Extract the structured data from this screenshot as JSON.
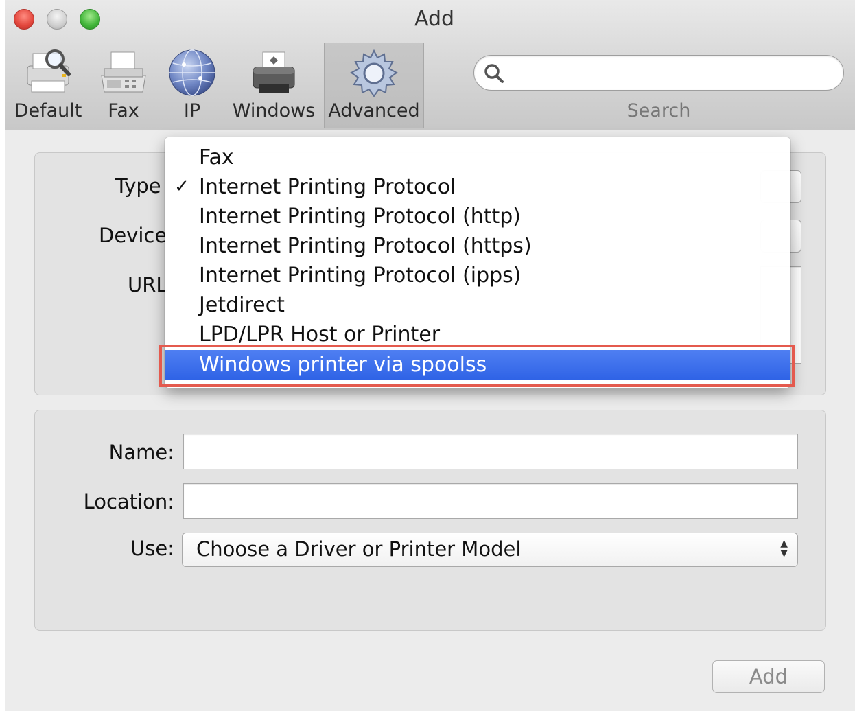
{
  "window": {
    "title": "Add"
  },
  "toolbar": {
    "items": [
      {
        "label": "Default",
        "icon": "default-printer-icon"
      },
      {
        "label": "Fax",
        "icon": "fax-icon"
      },
      {
        "label": "IP",
        "icon": "globe-icon"
      },
      {
        "label": "Windows",
        "icon": "printer-icon"
      },
      {
        "label": "Advanced",
        "icon": "gear-icon",
        "selected": true
      }
    ],
    "search": {
      "label": "Search",
      "value": ""
    }
  },
  "connection_group": {
    "type_label": "Type",
    "device_label": "Device",
    "url_label": "URL"
  },
  "dropdown_menu": {
    "items": [
      {
        "label": "Fax",
        "checked": false,
        "highlighted": false
      },
      {
        "label": "Internet Printing Protocol",
        "checked": true,
        "highlighted": false
      },
      {
        "label": "Internet Printing Protocol (http)",
        "checked": false,
        "highlighted": false
      },
      {
        "label": "Internet Printing Protocol (https)",
        "checked": false,
        "highlighted": false
      },
      {
        "label": "Internet Printing Protocol (ipps)",
        "checked": false,
        "highlighted": false
      },
      {
        "label": "Jetdirect",
        "checked": false,
        "highlighted": false
      },
      {
        "label": "LPD/LPR Host or Printer",
        "checked": false,
        "highlighted": false
      },
      {
        "label": "Windows printer via spoolss",
        "checked": false,
        "highlighted": true
      }
    ],
    "check_glyph": "✓",
    "annotation_color": "#e45a4e"
  },
  "printer_info": {
    "name_label": "Name:",
    "name_value": "",
    "location_label": "Location:",
    "location_value": "",
    "use_label": "Use:",
    "use_value": "Choose a Driver or Printer Model"
  },
  "footer": {
    "add_button_label": "Add"
  },
  "colors": {
    "highlight": "#2f63e6",
    "close": "#e2463c",
    "minimize": "#cfcfcf",
    "maximize": "#42b53a"
  }
}
